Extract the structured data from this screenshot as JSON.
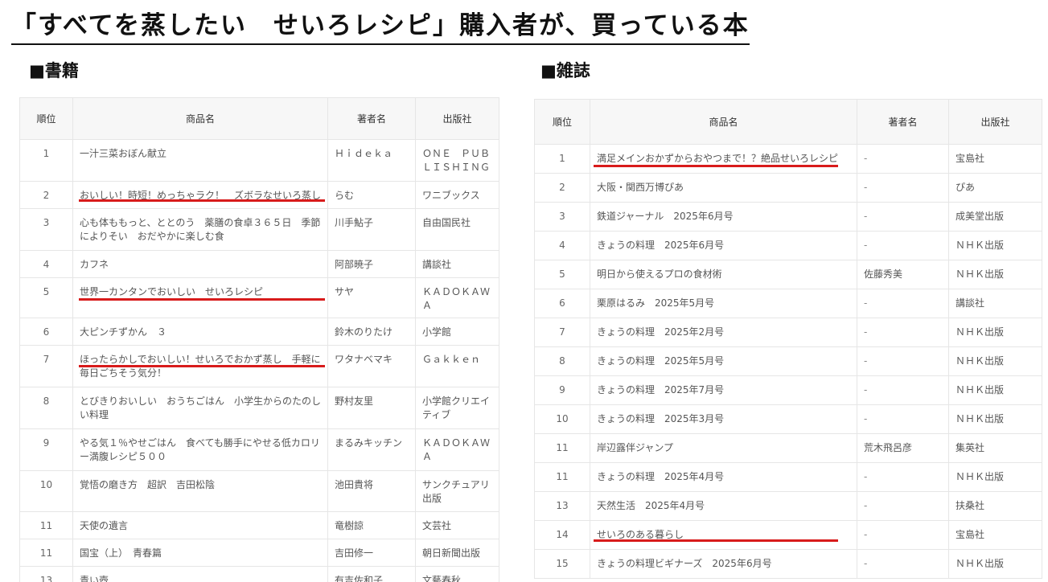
{
  "title": "「すべてを蒸したい　せいろレシピ」購入者が、買っている本",
  "books": {
    "section_title": "■書籍",
    "columns": [
      "順位",
      "商品名",
      "著者名",
      "出版社"
    ],
    "rows": [
      {
        "rank": "1",
        "name": "一汁三菜おぼん献立",
        "author": "Ｈｉｄｅｋａ",
        "publisher": "ＯＮＥ　ＰＵＢＬＩＳＨＩＮＧ"
      },
      {
        "rank": "2",
        "name": "おいしい！時短！めっちゃラク！　ズボラなせいろ蒸し",
        "author": "らむ",
        "publisher": "ワニブックス"
      },
      {
        "rank": "3",
        "name": "心も体ももっと、ととのう　薬膳の食卓３６５日　季節によりそい　おだやかに楽しむ食",
        "author": "川手鮎子",
        "publisher": "自由国民社"
      },
      {
        "rank": "4",
        "name": "カフネ",
        "author": "阿部暁子",
        "publisher": "講談社"
      },
      {
        "rank": "5",
        "name": "世界一カンタンでおいしい　せいろレシピ",
        "author": "サヤ",
        "publisher": "ＫＡＤＯＫＡＷＡ"
      },
      {
        "rank": "6",
        "name": "大ピンチずかん　３",
        "author": "鈴木のりたけ",
        "publisher": "小学館"
      },
      {
        "rank": "7",
        "name": "ほったらかしでおいしい！せいろでおかず蒸し　手軽に毎日ごちそう気分！",
        "author": "ワタナベマキ",
        "publisher": "Ｇａｋｋｅｎ"
      },
      {
        "rank": "8",
        "name": "とびきりおいしい　おうちごはん　小学生からのたのしい料理",
        "author": "野村友里",
        "publisher": "小学館クリエイティブ"
      },
      {
        "rank": "9",
        "name": "やる気１％やせごはん　食べても勝手にやせる低カロリー満腹レシピ５００",
        "author": "まるみキッチン",
        "publisher": "ＫＡＤＯＫＡＷＡ"
      },
      {
        "rank": "10",
        "name": "覚悟の磨き方　超訳　吉田松陰",
        "author": "池田貴将",
        "publisher": "サンクチュアリ出版"
      },
      {
        "rank": "11",
        "name": "天使の遺言",
        "author": "竜樹諒",
        "publisher": "文芸社"
      },
      {
        "rank": "11",
        "name": "国宝（上）　青春篇",
        "author": "吉田修一",
        "publisher": "朝日新聞出版"
      },
      {
        "rank": "13",
        "name": "青い壺",
        "author": "有吉佐和子",
        "publisher": "文藝春秋"
      }
    ]
  },
  "magazines": {
    "section_title": "■雑誌",
    "columns": [
      "順位",
      "商品名",
      "著者名",
      "出版社"
    ],
    "rows": [
      {
        "rank": "1",
        "name": "満足メインおかずからおやつまで！？絶品せいろレシピ",
        "author": "-",
        "publisher": "宝島社"
      },
      {
        "rank": "2",
        "name": "大阪・関西万博ぴあ",
        "author": "-",
        "publisher": "ぴあ"
      },
      {
        "rank": "3",
        "name": "鉄道ジャーナル　2025年6月号",
        "author": "-",
        "publisher": "成美堂出版"
      },
      {
        "rank": "4",
        "name": "きょうの料理　2025年6月号",
        "author": "-",
        "publisher": "ＮＨＫ出版"
      },
      {
        "rank": "5",
        "name": "明日から使えるプロの食材術",
        "author": "佐藤秀美",
        "publisher": "ＮＨＫ出版"
      },
      {
        "rank": "6",
        "name": "栗原はるみ　2025年5月号",
        "author": "-",
        "publisher": "講談社"
      },
      {
        "rank": "7",
        "name": "きょうの料理　2025年2月号",
        "author": "-",
        "publisher": "ＮＨＫ出版"
      },
      {
        "rank": "8",
        "name": "きょうの料理　2025年5月号",
        "author": "-",
        "publisher": "ＮＨＫ出版"
      },
      {
        "rank": "9",
        "name": "きょうの料理　2025年7月号",
        "author": "-",
        "publisher": "ＮＨＫ出版"
      },
      {
        "rank": "10",
        "name": "きょうの料理　2025年3月号",
        "author": "-",
        "publisher": "ＮＨＫ出版"
      },
      {
        "rank": "11",
        "name": "岸辺露伴ジャンプ",
        "author": "荒木飛呂彦",
        "publisher": "集英社"
      },
      {
        "rank": "11",
        "name": "きょうの料理　2025年4月号",
        "author": "-",
        "publisher": "ＮＨＫ出版"
      },
      {
        "rank": "13",
        "name": "天然生活　2025年4月号",
        "author": "-",
        "publisher": "扶桑社"
      },
      {
        "rank": "14",
        "name": "せいろのある暮らし",
        "author": "-",
        "publisher": "宝島社"
      },
      {
        "rank": "15",
        "name": "きょうの料理ビギナーズ　2025年6月号",
        "author": "-",
        "publisher": "ＮＨＫ出版"
      }
    ]
  },
  "highlight_color": "#d81b1b"
}
